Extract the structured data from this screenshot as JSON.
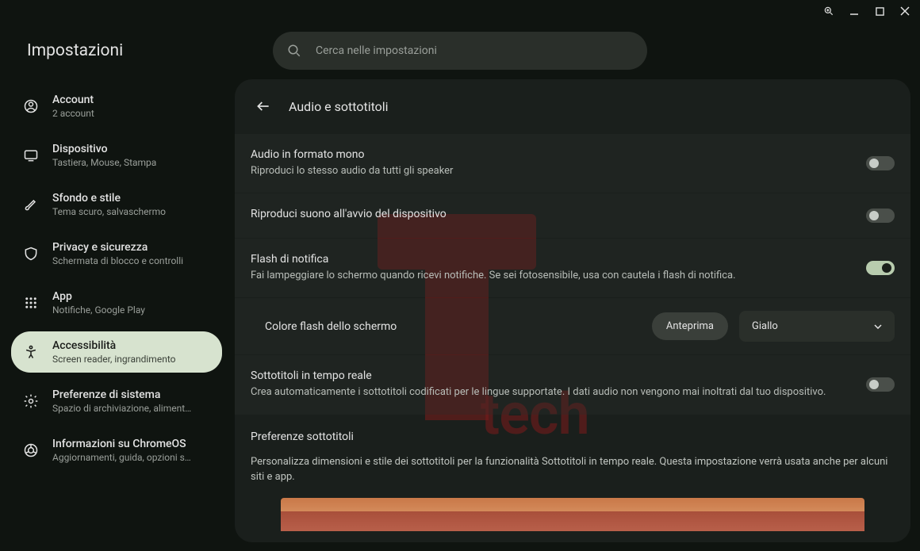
{
  "app": {
    "title": "Impostazioni"
  },
  "search": {
    "placeholder": "Cerca nelle impostazioni"
  },
  "sidebar": {
    "items": [
      {
        "title": "Account",
        "sub": "2 account"
      },
      {
        "title": "Dispositivo",
        "sub": "Tastiera, Mouse, Stampa"
      },
      {
        "title": "Sfondo e stile",
        "sub": "Tema scuro, salvaschermo"
      },
      {
        "title": "Privacy e sicurezza",
        "sub": "Schermata di blocco e controlli"
      },
      {
        "title": "App",
        "sub": "Notifiche, Google Play"
      },
      {
        "title": "Accessibilità",
        "sub": "Screen reader, ingrandimento"
      },
      {
        "title": "Preferenze di sistema",
        "sub": "Spazio di archiviazione, aliment…"
      },
      {
        "title": "Informazioni su ChromeOS",
        "sub": "Aggiornamenti, guida, opzioni s…"
      }
    ]
  },
  "panel": {
    "heading": "Audio e sottotitoli",
    "rows": {
      "mono": {
        "title": "Audio in formato mono",
        "desc": "Riproduci lo stesso audio da tutti gli speaker"
      },
      "startup": {
        "title": "Riproduci suono all'avvio del dispositivo"
      },
      "flash": {
        "title": "Flash di notifica",
        "desc": "Fai lampeggiare lo schermo quando ricevi notifiche. Se sei fotosensibile, usa con cautela i flash di notifica."
      },
      "flashcolor": {
        "label": "Colore flash dello schermo",
        "preview": "Anteprima",
        "value": "Giallo"
      },
      "live": {
        "title": "Sottotitoli in tempo reale",
        "desc": "Crea automaticamente i sottotitoli codificati per le lingue supportate. I dati audio non vengono mai inoltrati dal tuo dispositivo."
      }
    },
    "caption_section": {
      "title": "Preferenze sottotitoli",
      "desc": "Personalizza dimensioni e stile dei sottotitoli per la funzionalità Sottotitoli in tempo reale. Questa impostazione verrà usata anche per alcuni siti e app."
    }
  },
  "watermark": "tech"
}
